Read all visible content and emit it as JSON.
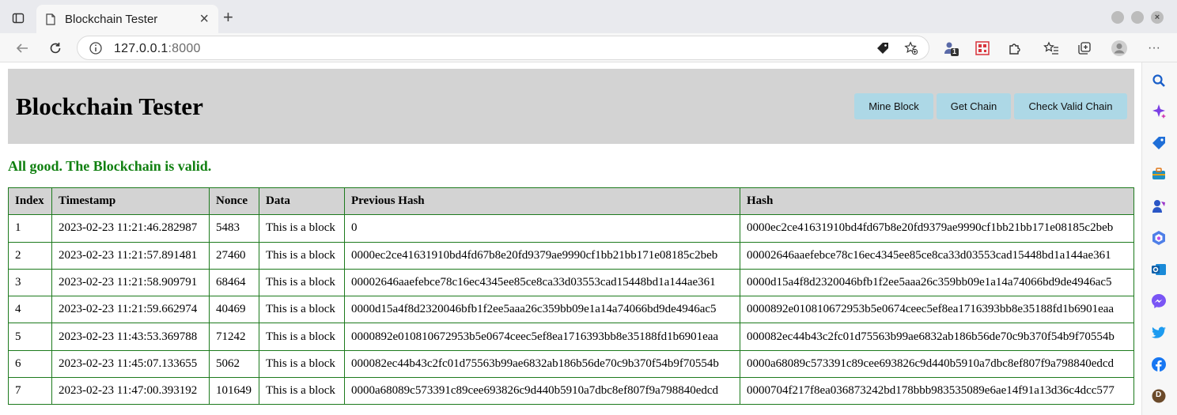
{
  "browser": {
    "tab_title": "Blockchain Tester",
    "new_tab_label": "+",
    "url_host": "127.0.0.1",
    "url_port": ":8000",
    "extension_badge": "1",
    "profile_letter": "D",
    "menu_label": "···"
  },
  "header": {
    "title": "Blockchain Tester",
    "buttons": [
      "Mine Block",
      "Get Chain",
      "Check Valid Chain"
    ]
  },
  "status": {
    "text": "All good. The Blockchain is valid.",
    "color": "#118011"
  },
  "table": {
    "columns": [
      "Index",
      "Timestamp",
      "Nonce",
      "Data",
      "Previous Hash",
      "Hash"
    ],
    "rows": [
      [
        "1",
        "2023-02-23 11:21:46.282987",
        "5483",
        "This is a block",
        "0",
        "0000ec2ce41631910bd4fd67b8e20fd9379ae9990cf1bb21bb171e08185c2beb"
      ],
      [
        "2",
        "2023-02-23 11:21:57.891481",
        "27460",
        "This is a block",
        "0000ec2ce41631910bd4fd67b8e20fd9379ae9990cf1bb21bb171e08185c2beb",
        "00002646aaefebce78c16ec4345ee85ce8ca33d03553cad15448bd1a144ae361"
      ],
      [
        "3",
        "2023-02-23 11:21:58.909791",
        "68464",
        "This is a block",
        "00002646aaefebce78c16ec4345ee85ce8ca33d03553cad15448bd1a144ae361",
        "0000d15a4f8d2320046bfb1f2ee5aaa26c359bb09e1a14a74066bd9de4946ac5"
      ],
      [
        "4",
        "2023-02-23 11:21:59.662974",
        "40469",
        "This is a block",
        "0000d15a4f8d2320046bfb1f2ee5aaa26c359bb09e1a14a74066bd9de4946ac5",
        "0000892e010810672953b5e0674ceec5ef8ea1716393bb8e35188fd1b6901eaa"
      ],
      [
        "5",
        "2023-02-23 11:43:53.369788",
        "71242",
        "This is a block",
        "0000892e010810672953b5e0674ceec5ef8ea1716393bb8e35188fd1b6901eaa",
        "000082ec44b43c2fc01d75563b99ae6832ab186b56de70c9b370f54b9f70554b"
      ],
      [
        "6",
        "2023-02-23 11:45:07.133655",
        "5062",
        "This is a block",
        "000082ec44b43c2fc01d75563b99ae6832ab186b56de70c9b370f54b9f70554b",
        "0000a68089c573391c89cee693826c9d440b5910a7dbc8ef807f9a798840edcd"
      ],
      [
        "7",
        "2023-02-23 11:47:00.393192",
        "101649",
        "This is a block",
        "0000a68089c573391c89cee693826c9d440b5910a7dbc8ef807f9a798840edcd",
        "0000704f217f8ea036873242bd178bbb983535089e6ae14f91a13d36c4dcc577"
      ]
    ]
  },
  "colors": {
    "header_bg": "#d3d3d3",
    "button_bg": "#add8e6",
    "table_border": "#1d7a1d"
  },
  "icons": {
    "toolbar": [
      "back-icon",
      "reload-icon",
      "info-icon",
      "tag-icon",
      "favorite-add-icon",
      "extension-badge-icon",
      "qr-icon",
      "puzzle-icon",
      "favorites-icon",
      "collections-icon",
      "profile-icon",
      "menu-icon"
    ],
    "sidebar": [
      "search-icon",
      "copilot-icon",
      "shopping-icon",
      "tools-icon",
      "games-icon",
      "m365-icon",
      "outlook-icon",
      "messenger-icon",
      "twitter-icon",
      "facebook-icon",
      "profile-d-icon"
    ]
  }
}
